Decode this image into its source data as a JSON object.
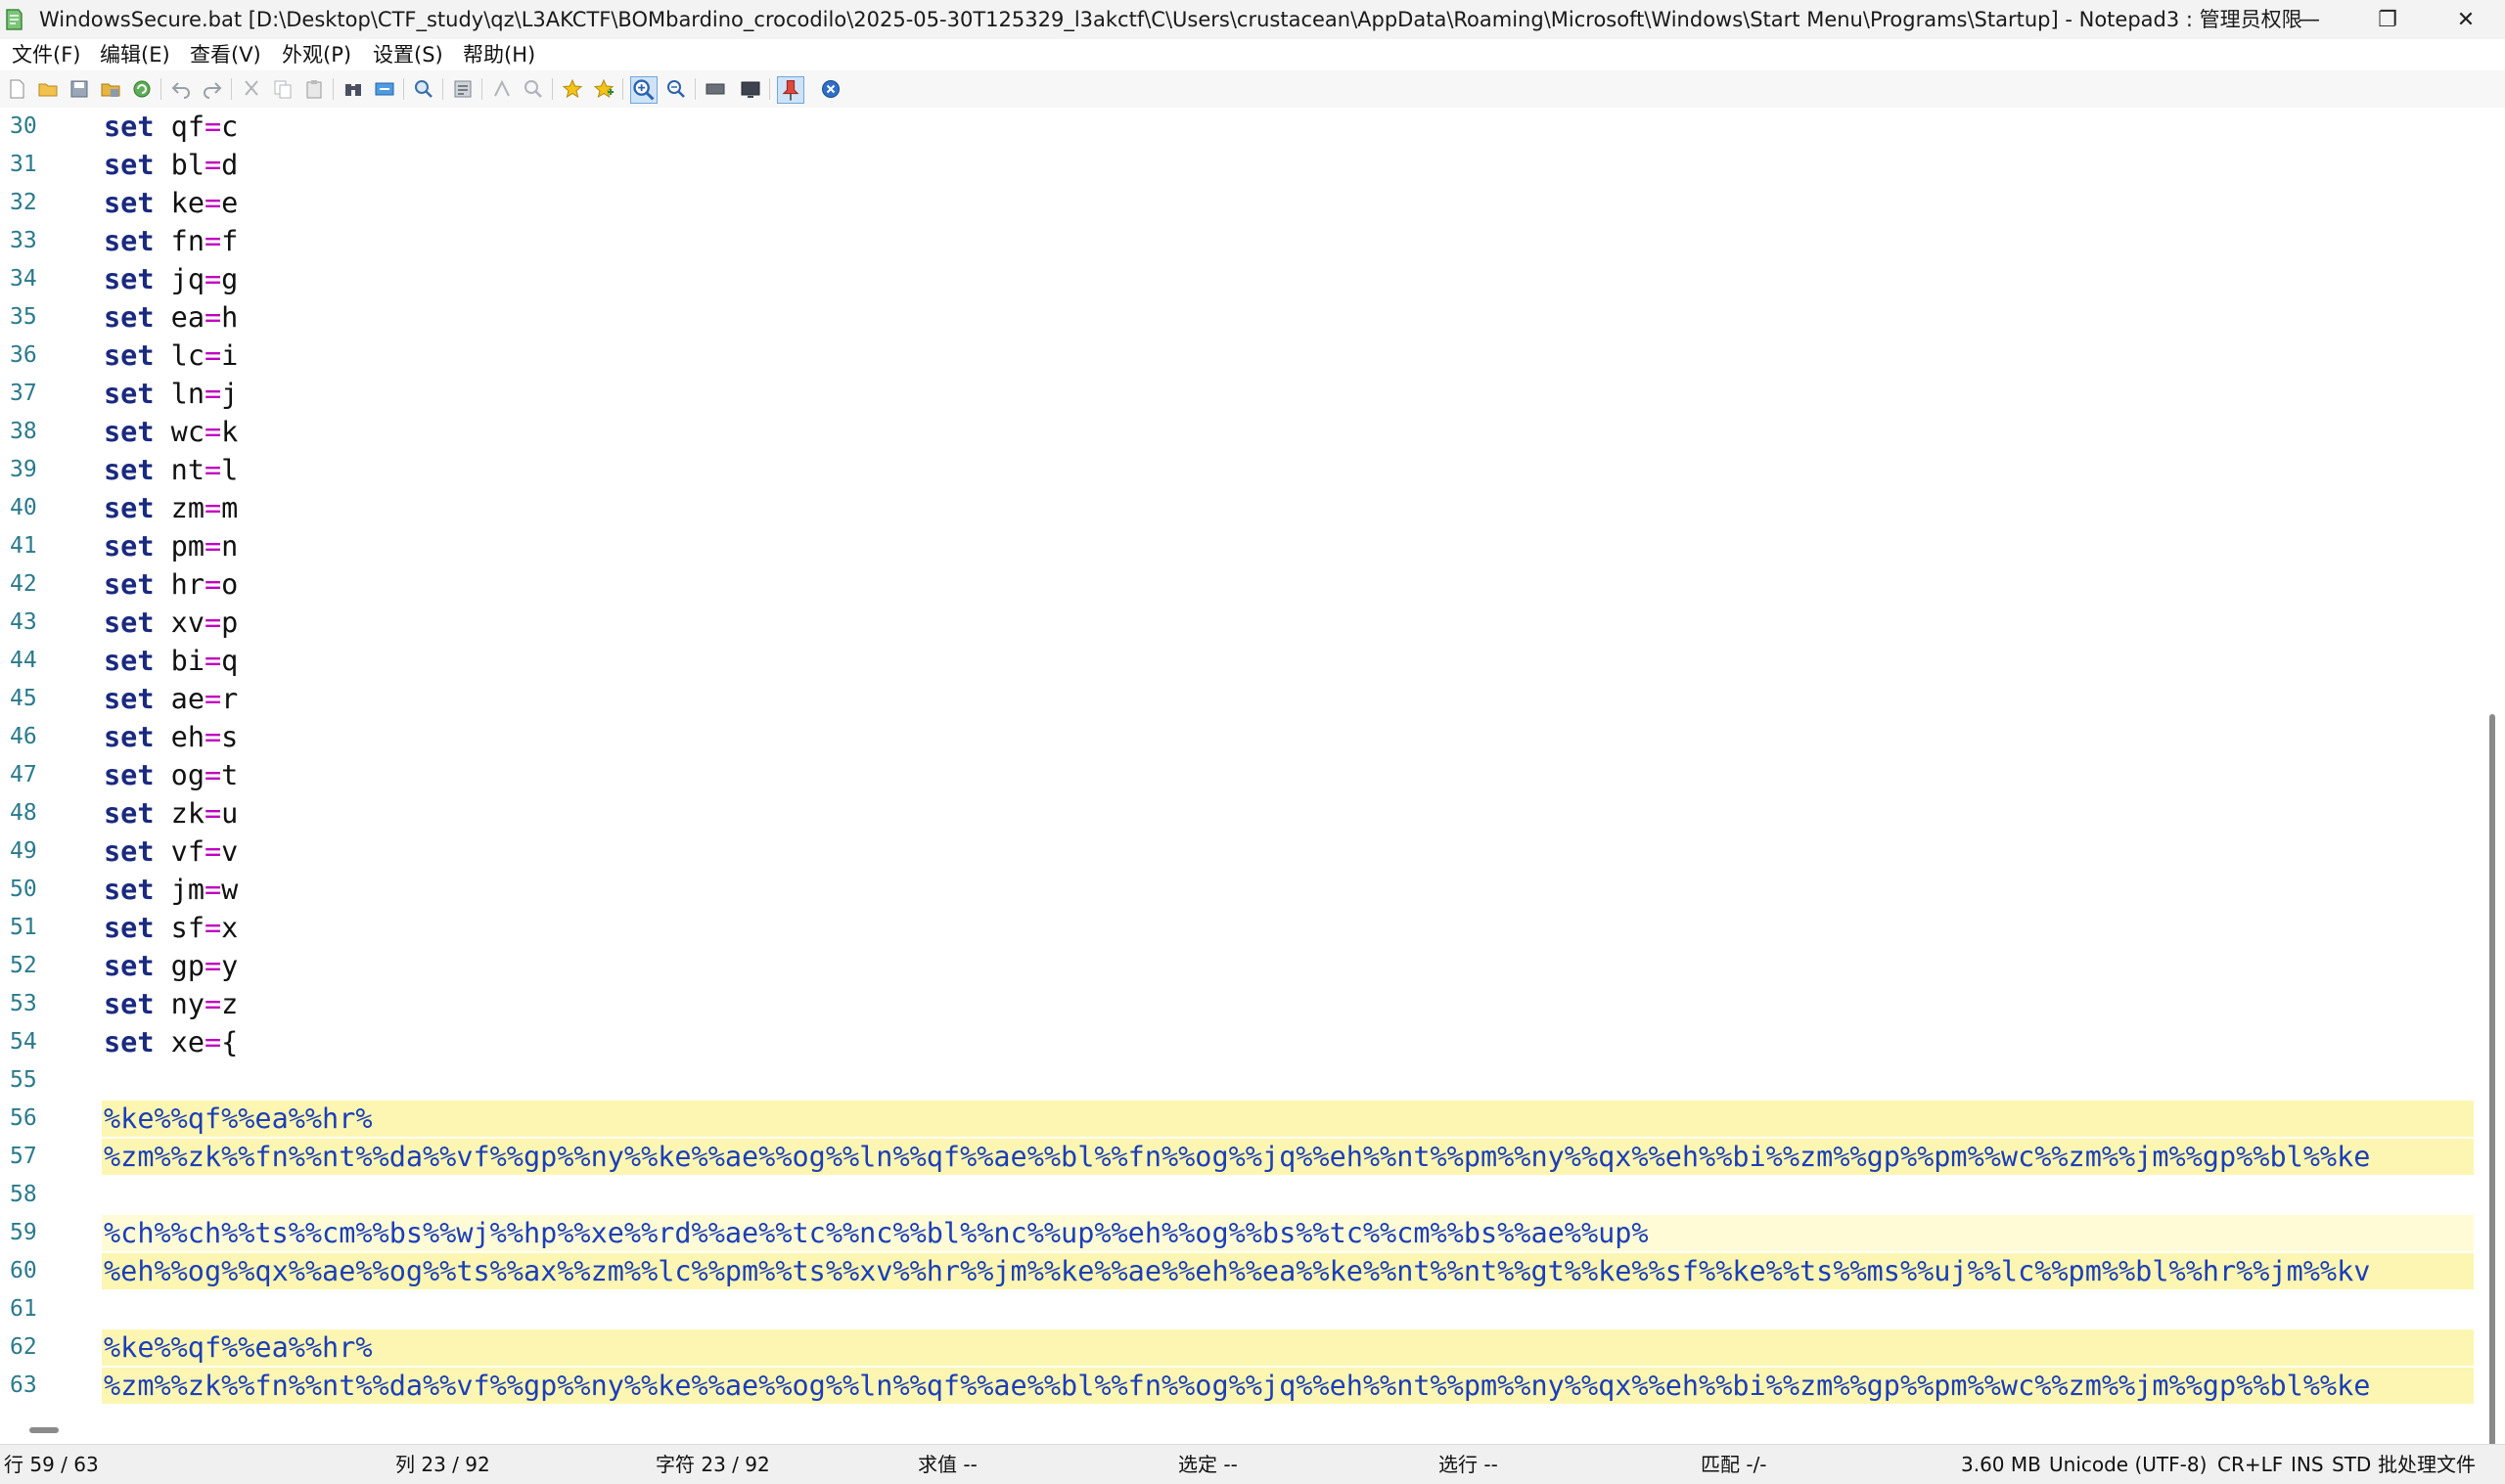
{
  "window": {
    "title": "WindowsSecure.bat [D:\\Desktop\\CTF_study\\qz\\L3AKCTF\\BOMbardino_crocodilo\\2025-05-30T125329_l3akctf\\C\\Users\\crustacean\\AppData\\Roaming\\Microsoft\\Windows\\Start Menu\\Programs\\Startup] - Notepad3 : 管理员权限",
    "minimize": "—",
    "maximize": "❐",
    "close": "✕"
  },
  "menu": [
    "文件(F)",
    "编辑(E)",
    "查看(V)",
    "外观(P)",
    "设置(S)",
    "帮助(H)"
  ],
  "editor": {
    "keyword": "set",
    "assignments": [
      {
        "num": "30",
        "name": "qf",
        "value": "c"
      },
      {
        "num": "31",
        "name": "bl",
        "value": "d"
      },
      {
        "num": "32",
        "name": "ke",
        "value": "e"
      },
      {
        "num": "33",
        "name": "fn",
        "value": "f"
      },
      {
        "num": "34",
        "name": "jq",
        "value": "g"
      },
      {
        "num": "35",
        "name": "ea",
        "value": "h"
      },
      {
        "num": "36",
        "name": "lc",
        "value": "i"
      },
      {
        "num": "37",
        "name": "ln",
        "value": "j"
      },
      {
        "num": "38",
        "name": "wc",
        "value": "k"
      },
      {
        "num": "39",
        "name": "nt",
        "value": "l"
      },
      {
        "num": "40",
        "name": "zm",
        "value": "m"
      },
      {
        "num": "41",
        "name": "pm",
        "value": "n"
      },
      {
        "num": "42",
        "name": "hr",
        "value": "o"
      },
      {
        "num": "43",
        "name": "xv",
        "value": "p"
      },
      {
        "num": "44",
        "name": "bi",
        "value": "q"
      },
      {
        "num": "45",
        "name": "ae",
        "value": "r"
      },
      {
        "num": "46",
        "name": "eh",
        "value": "s"
      },
      {
        "num": "47",
        "name": "og",
        "value": "t"
      },
      {
        "num": "48",
        "name": "zk",
        "value": "u"
      },
      {
        "num": "49",
        "name": "vf",
        "value": "v"
      },
      {
        "num": "50",
        "name": "jm",
        "value": "w"
      },
      {
        "num": "51",
        "name": "sf",
        "value": "x"
      },
      {
        "num": "52",
        "name": "gp",
        "value": "y"
      },
      {
        "num": "53",
        "name": "ny",
        "value": "z"
      },
      {
        "num": "54",
        "name": "xe",
        "value": "{"
      }
    ],
    "obfuscated": [
      {
        "num": "55",
        "text": "",
        "hl": ""
      },
      {
        "num": "56",
        "text": "%ke%%qf%%ea%%hr%",
        "hl": "yellow"
      },
      {
        "num": "57",
        "text": "%zm%%zk%%fn%%nt%%da%%vf%%gp%%ny%%ke%%ae%%og%%ln%%qf%%ae%%bl%%fn%%og%%jq%%eh%%nt%%pm%%ny%%qx%%eh%%bi%%zm%%gp%%pm%%wc%%zm%%jm%%gp%%bl%%ke",
        "hl": "yellow"
      },
      {
        "num": "58",
        "text": "",
        "hl": ""
      },
      {
        "num": "59",
        "text": "%ch%%ch%%ts%%cm%%bs%%wj%%hp%%xe%%rd%%ae%%tc%%nc%%bl%%nc%%up%%eh%%og%%bs%%tc%%cm%%bs%%ae%%up%",
        "hl": "current"
      },
      {
        "num": "60",
        "text": "%eh%%og%%qx%%ae%%og%%ts%%ax%%zm%%lc%%pm%%ts%%xv%%hr%%jm%%ke%%ae%%eh%%ea%%ke%%nt%%nt%%gt%%ke%%sf%%ke%%ts%%ms%%uj%%lc%%pm%%bl%%hr%%jm%%kv",
        "hl": "yellow"
      },
      {
        "num": "61",
        "text": "",
        "hl": ""
      },
      {
        "num": "62",
        "text": "%ke%%qf%%ea%%hr%",
        "hl": "yellow"
      },
      {
        "num": "63",
        "text": "%zm%%zk%%fn%%nt%%da%%vf%%gp%%ny%%ke%%ae%%og%%ln%%qf%%ae%%bl%%fn%%og%%jq%%eh%%nt%%pm%%ny%%qx%%eh%%bi%%zm%%gp%%pm%%wc%%zm%%jm%%gp%%bl%%ke",
        "hl": "yellow"
      }
    ]
  },
  "status": {
    "line": "行  59 / 63",
    "col": "列  23 / 92",
    "char": "字符  23 / 92",
    "eval": "求值  --",
    "sel": "选定  --",
    "sellines": "选行  --",
    "match": "匹配  -/-",
    "size": "3.60 MB",
    "encoding": "Unicode (UTF-8)",
    "eol": "CR+LF",
    "ins": "INS",
    "std": "STD",
    "lexer": "批处理文件"
  },
  "colors": {
    "keyword": "#1a2a80",
    "equals": "#c000c0",
    "variable_ref": "#1b3fb8",
    "line_number": "#2a7a8c",
    "highlight": "#fdf6b2",
    "current_line": "#fffbd6"
  }
}
